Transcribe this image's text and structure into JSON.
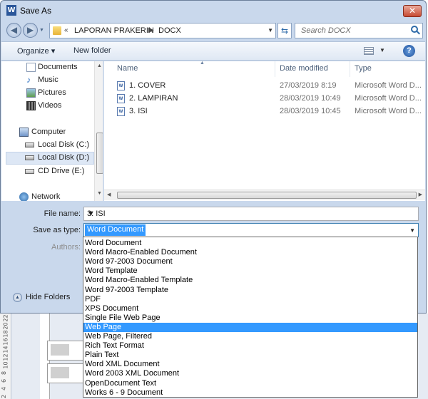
{
  "window": {
    "title": "Save As",
    "app_icon": "word-icon",
    "close_glyph": "✕"
  },
  "address": {
    "crumbs": [
      "LAPORAN PRAKERIN",
      "DOCX"
    ],
    "search_placeholder": "Search DOCX"
  },
  "toolbar": {
    "organize": "Organize ▾",
    "new_folder": "New folder"
  },
  "nav": {
    "items": [
      {
        "label": "Documents",
        "icon": "documents-icon"
      },
      {
        "label": "Music",
        "icon": "music-icon"
      },
      {
        "label": "Pictures",
        "icon": "pictures-icon"
      },
      {
        "label": "Videos",
        "icon": "videos-icon"
      },
      {
        "label": "Computer",
        "icon": "computer-icon"
      },
      {
        "label": "Local Disk (C:)",
        "icon": "drive-icon"
      },
      {
        "label": "Local Disk (D:)",
        "icon": "drive-icon",
        "selected": true
      },
      {
        "label": "CD Drive (E:)",
        "icon": "cd-drive-icon"
      },
      {
        "label": "Network",
        "icon": "network-icon"
      }
    ]
  },
  "files": {
    "columns": {
      "name": "Name",
      "date": "Date modified",
      "type": "Type"
    },
    "rows": [
      {
        "name": "1. COVER",
        "date": "27/03/2019 8:19",
        "type": "Microsoft Word D..."
      },
      {
        "name": "2. LAMPIRAN",
        "date": "28/03/2019 10:49",
        "type": "Microsoft Word D..."
      },
      {
        "name": "3. ISI",
        "date": "28/03/2019 10:45",
        "type": "Microsoft Word D..."
      }
    ]
  },
  "form": {
    "filename_label": "File name:",
    "filename_value": "3. ISI",
    "savetype_label": "Save as type:",
    "savetype_value": "Word Document",
    "authors_label": "Authors:"
  },
  "hide_folders": "Hide Folders",
  "save_types": [
    "Word Document",
    "Word Macro-Enabled Document",
    "Word 97-2003 Document",
    "Word Template",
    "Word Macro-Enabled Template",
    "Word 97-2003 Template",
    "PDF",
    "XPS Document",
    "Single File Web Page",
    "Web Page",
    "Web Page, Filtered",
    "Rich Text Format",
    "Plain Text",
    "Word XML Document",
    "Word 2003 XML Document",
    "OpenDocument Text",
    "Works 6 - 9 Document"
  ],
  "save_types_highlighted": "Web Page",
  "ruler_marks": [
    "2",
    "4",
    "6",
    "8",
    "10",
    "12",
    "14",
    "16",
    "18",
    "20",
    "22"
  ]
}
